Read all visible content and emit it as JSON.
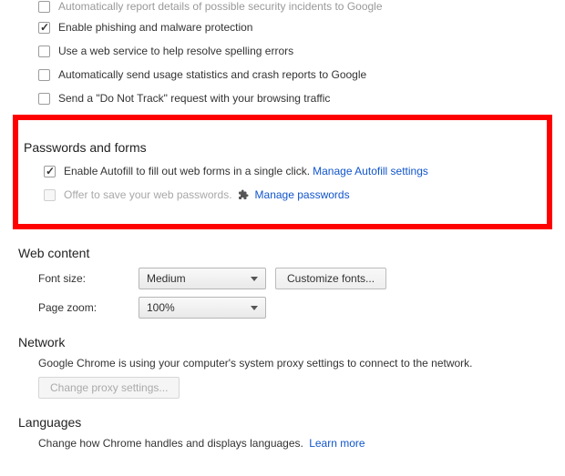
{
  "privacy": {
    "opt0": "Automatically report details of possible security incidents to Google",
    "opt1": "Enable phishing and malware protection",
    "opt2": "Use a web service to help resolve spelling errors",
    "opt3": "Automatically send usage statistics and crash reports to Google",
    "opt4": "Send a \"Do Not Track\" request with your browsing traffic"
  },
  "passwords_forms": {
    "heading": "Passwords and forms",
    "autofill_label": "Enable Autofill to fill out web forms in a single click.",
    "autofill_link": "Manage Autofill settings",
    "save_pw_label": "Offer to save your web passwords.",
    "save_pw_link": "Manage passwords"
  },
  "web_content": {
    "heading": "Web content",
    "font_size_label": "Font size:",
    "font_size_value": "Medium",
    "customize_fonts": "Customize fonts...",
    "page_zoom_label": "Page zoom:",
    "page_zoom_value": "100%"
  },
  "network": {
    "heading": "Network",
    "desc": "Google Chrome is using your computer's system proxy settings to connect to the network.",
    "change_proxy": "Change proxy settings..."
  },
  "languages": {
    "heading": "Languages",
    "desc": "Change how Chrome handles and displays languages.",
    "learn_more": "Learn more"
  }
}
